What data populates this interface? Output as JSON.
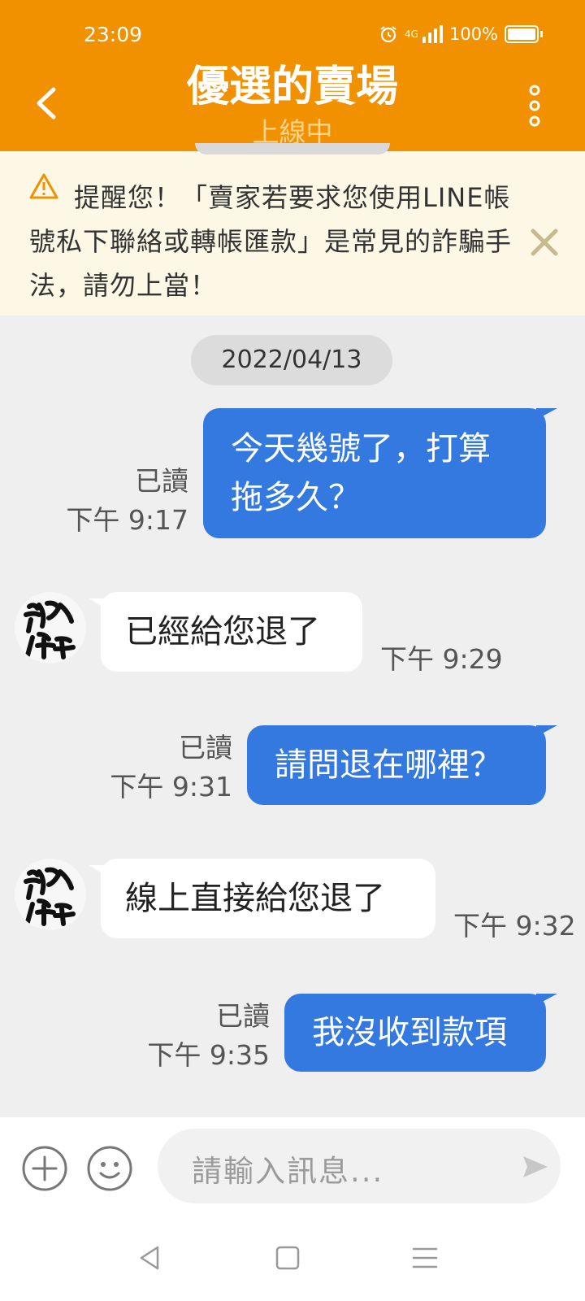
{
  "status_bar": {
    "time": "23:09",
    "network": "4G",
    "battery": "100%"
  },
  "header": {
    "title": "優選的賣場",
    "subtitle": "上線中"
  },
  "warning": {
    "text": "提醒您！「賣家若要求您使用LINE帳號私下聯絡或轉帳匯款」是常見的詐騙手法，請勿上當！"
  },
  "chat": {
    "date": "2022/04/13",
    "messages": [
      {
        "side": "out",
        "text": "今天幾號了，打算拖多久？",
        "status": "已讀",
        "time": "下午 9:17"
      },
      {
        "side": "in",
        "text": "已經給您退了",
        "time": "下午 9:29"
      },
      {
        "side": "out",
        "text": "請問退在哪裡？",
        "status": "已讀",
        "time": "下午 9:31"
      },
      {
        "side": "in",
        "text": "線上直接給您退了",
        "time": "下午 9:32"
      },
      {
        "side": "out",
        "text": "我沒收到款項",
        "status": "已讀",
        "time": "下午 9:35"
      }
    ]
  },
  "input": {
    "placeholder": "請輸入訊息..."
  },
  "colors": {
    "header": "#f29100",
    "outgoing_bubble": "#3479e0",
    "warning_bg": "#fdf8e6"
  },
  "icons": [
    "back-arrow-icon",
    "more-vertical-icon",
    "warning-triangle-icon",
    "close-icon",
    "plus-icon",
    "emoji-icon",
    "send-icon",
    "nav-back-icon",
    "nav-home-icon",
    "nav-menu-icon"
  ]
}
